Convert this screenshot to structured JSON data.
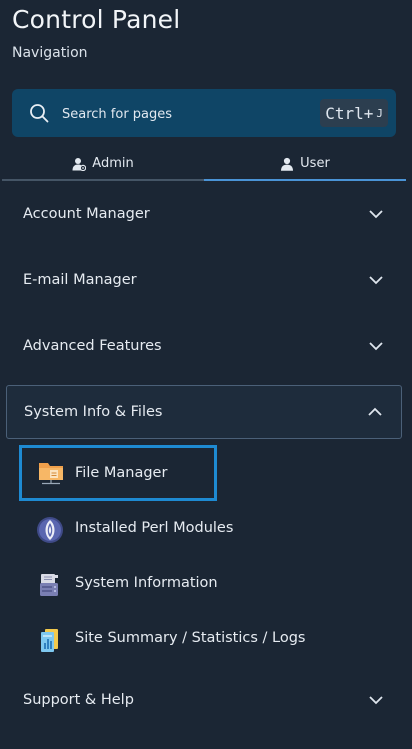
{
  "header": {
    "title": "Control Panel",
    "subtitle": "Navigation"
  },
  "search": {
    "placeholder": "Search for pages",
    "shortcut_main": "Ctrl+",
    "shortcut_key": "J"
  },
  "tabs": [
    {
      "label": "Admin",
      "icon": "admin-user-icon",
      "active": false
    },
    {
      "label": "User",
      "icon": "user-icon",
      "active": true
    }
  ],
  "sections": [
    {
      "label": "Account Manager",
      "expanded": false
    },
    {
      "label": "E-mail Manager",
      "expanded": false
    },
    {
      "label": "Advanced Features",
      "expanded": false
    },
    {
      "label": "System Info & Files",
      "expanded": true
    },
    {
      "label": "Support & Help",
      "expanded": false
    }
  ],
  "system_info_items": [
    {
      "label": "File Manager",
      "icon": "folder-icon",
      "selected": true
    },
    {
      "label": "Installed Perl Modules",
      "icon": "perl-onion-icon",
      "selected": false
    },
    {
      "label": "System Information",
      "icon": "server-icon",
      "selected": false
    },
    {
      "label": "Site Summary / Statistics / Logs",
      "icon": "stats-icon",
      "selected": false
    }
  ],
  "colors": {
    "background": "#1b2634",
    "search_bg": "#0f4566",
    "active_tab_underline": "#4a93d6",
    "selected_outline": "#1e8ad2"
  }
}
